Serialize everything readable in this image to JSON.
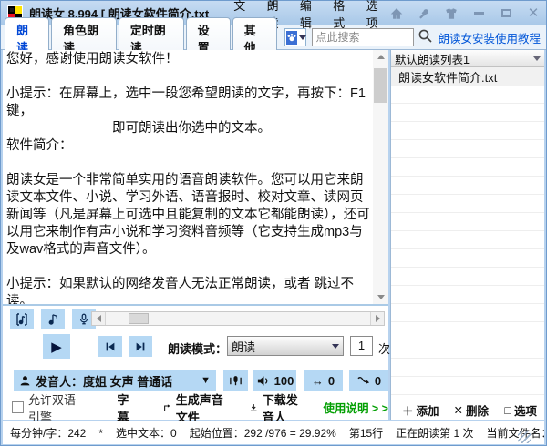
{
  "window": {
    "title": "朗读女 8.994  [ 朗读女软件简介.txt",
    "menu": [
      "文件",
      "朗读",
      "编辑",
      "格式",
      "选项"
    ]
  },
  "tabs": [
    {
      "label": "朗读"
    },
    {
      "label": "角色朗读"
    },
    {
      "label": "定时朗读"
    },
    {
      "label": "设置"
    },
    {
      "label": "其他"
    }
  ],
  "toolbar": {
    "search_placeholder": "点此搜索",
    "tutorial_link": "朗读女安装使用教程"
  },
  "editor": {
    "text": "您好，感谢使用朗读女软件！\n\n小提示：在屏幕上，选中一段您希望朗读的文字，再按下：F1键，\n　　　　　　　　即可朗读出你选中的文本。\n软件简介：\n\n朗读女是一个非常简单实用的语音朗读软件。您可以用它来朗读文本文件、小说、学习外语、语音报时、校对文章、读网页新闻等（凡是屏幕上可选中且能复制的文本它都能朗读），还可以用它来制作有声小说和学习资料音频等（它支持生成mp3与及wav格式的声音文件）。\n\n小提示：如果默认的网络发音人无法正常朗读，或者 跳过不读。\n　　　请【 清空发音人缓存文件 】再试试!\n　　　　　或者 下载安装一个发音人来读。"
  },
  "playback": {
    "mode_label": "朗读模式：",
    "mode_value": "朗读",
    "times_value": "1",
    "times_label": "次"
  },
  "voice": {
    "label": "发音人：度姐 女声 普通话",
    "volume": "100",
    "speed": "0",
    "pitch": "0"
  },
  "options_row": {
    "bilingual": "允许双语引擎",
    "subtitle": "字幕",
    "generate": "生成声音文件",
    "download": "下载发音人",
    "usage": "使用说明 > >"
  },
  "playlist": {
    "dropdown": "默认朗读列表1",
    "items": [
      "朗读女软件简介.txt"
    ],
    "add": "添加",
    "remove": "删除",
    "options": "选项"
  },
  "statusbar": {
    "rate": "每分钟/字：242",
    "star": "*",
    "selected": "选中文本：0",
    "position": "起始位置：292 /976 = 29.92%",
    "line": "第15行",
    "reading": "正在朗读第 1 次",
    "filename": "当前文件名：朗读女软"
  },
  "glyphs": {
    "dropdown_arrow": "▼",
    "speed_icon": "↔",
    "play_icon": "▶",
    "add_icon": "＋",
    "remove_icon": "✕",
    "options_icon": "□"
  },
  "colors": {
    "accent_blue": "#b5d8f4",
    "chrome_blue": "#b7d2ee",
    "link_blue": "#0055d8",
    "active_tab_blue": "#0046d5",
    "usage_green": "#04a004"
  }
}
